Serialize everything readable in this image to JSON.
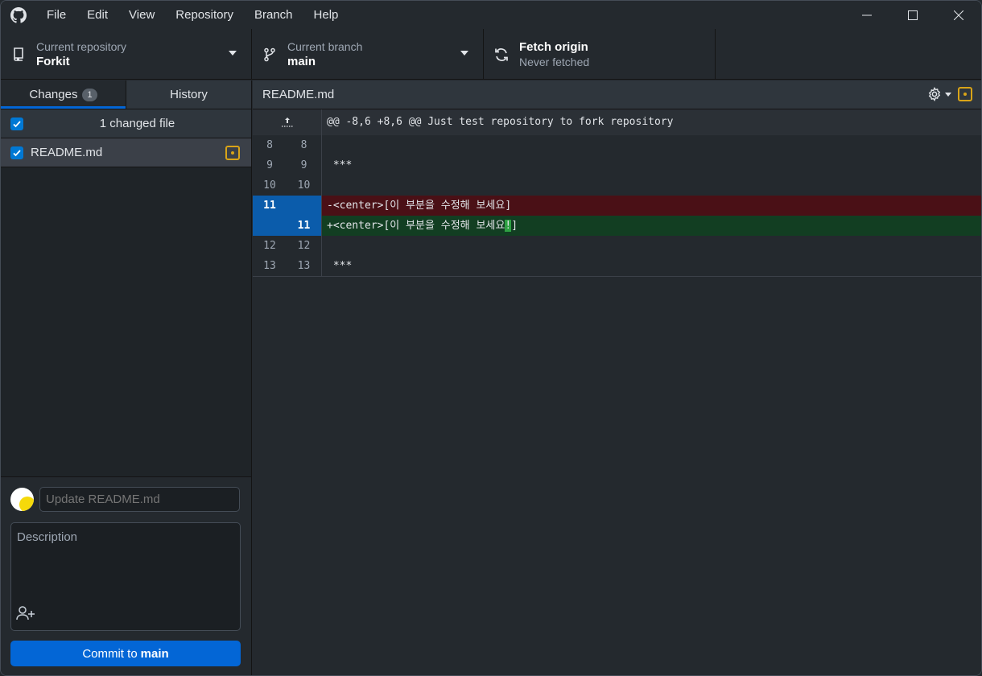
{
  "menu": [
    "File",
    "Edit",
    "View",
    "Repository",
    "Branch",
    "Help"
  ],
  "toolbar": {
    "repo_label": "Current repository",
    "repo_value": "Forkit",
    "branch_label": "Current branch",
    "branch_value": "main",
    "fetch_label": "Fetch origin",
    "fetch_value": "Never fetched"
  },
  "sidebar": {
    "tab_changes": "Changes",
    "tab_changes_count": "1",
    "tab_history": "History",
    "changed_header": "1 changed file",
    "files": [
      {
        "name": "README.md",
        "status": "modified"
      }
    ]
  },
  "commit": {
    "summary_placeholder": "Update README.md",
    "description_placeholder": "Description",
    "button_prefix": "Commit to",
    "button_branch": "main"
  },
  "diff": {
    "filename": "README.md",
    "hunk": "@@ -8,6 +8,6 @@ Just test repository to fork repository",
    "lines": [
      {
        "old": "8",
        "new": "8",
        "text": ""
      },
      {
        "old": "9",
        "new": "9",
        "text": " ***"
      },
      {
        "old": "10",
        "new": "10",
        "text": ""
      },
      {
        "old": "11",
        "new": "",
        "text": "-<center>[이 부분을 수정해 보세요]"
      },
      {
        "old": "",
        "new": "11",
        "text_before": "+<center>[이 부분을 수정해 보세요",
        "text_hl": "!",
        "text_after": "]"
      },
      {
        "old": "12",
        "new": "12",
        "text": ""
      },
      {
        "old": "13",
        "new": "13",
        "text": " ***"
      }
    ]
  },
  "colors": {
    "accent": "#0366d6",
    "modified": "#d9a418",
    "deleted_bg": "#4a1016",
    "added_bg": "#123e22"
  }
}
